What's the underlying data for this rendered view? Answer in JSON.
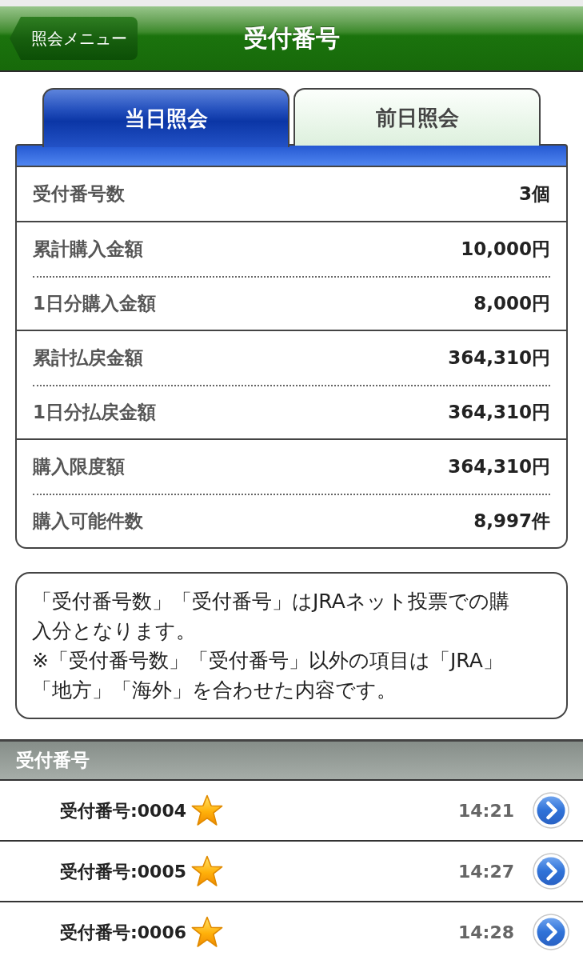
{
  "header": {
    "back_button": "照会メニュー",
    "title": "受付番号"
  },
  "tabs": [
    {
      "label": "当日照会",
      "selected": true
    },
    {
      "label": "前日照会",
      "selected": false
    }
  ],
  "summary": [
    {
      "rows": [
        {
          "label": "受付番号数",
          "value": "3個"
        }
      ]
    },
    {
      "rows": [
        {
          "label": "累計購入金額",
          "value": "10,000円"
        },
        {
          "label": "1日分購入金額",
          "value": "8,000円"
        }
      ]
    },
    {
      "rows": [
        {
          "label": "累計払戻金額",
          "value": "364,310円"
        },
        {
          "label": "1日分払戻金額",
          "value": "364,310円"
        }
      ]
    },
    {
      "rows": [
        {
          "label": "購入限度額",
          "value": "364,310円"
        },
        {
          "label": "購入可能件数",
          "value": "8,997件"
        }
      ]
    }
  ],
  "note": [
    "「受付番号数」「受付番号」はJRAネット投票での購入分となります。",
    "※「受付番号数」「受付番号」以外の項目は「JRA」「地方」「海外」を合わせた内容です。"
  ],
  "receipts": {
    "heading": "受付番号",
    "items": [
      {
        "label": "受付番号:0004",
        "starred": true,
        "time": "14:21"
      },
      {
        "label": "受付番号:0005",
        "starred": true,
        "time": "14:27"
      },
      {
        "label": "受付番号:0006",
        "starred": true,
        "time": "14:28"
      }
    ]
  }
}
